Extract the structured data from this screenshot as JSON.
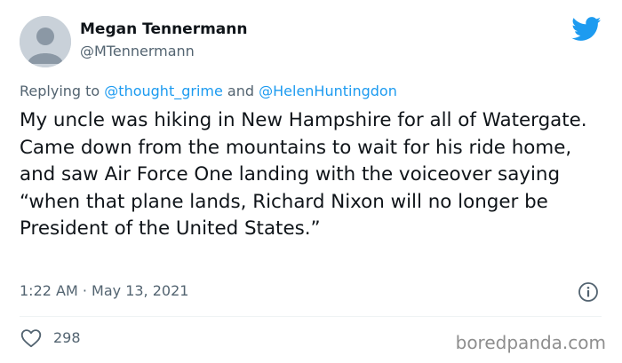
{
  "author": {
    "name": "Megan Tennermann",
    "handle": "@MTennermann"
  },
  "reply_context": {
    "prefix": "Replying to",
    "mention_1": "@thought_grime",
    "conjunction": "and",
    "mention_2": "@HelenHuntingdon"
  },
  "tweet": {
    "text": "My uncle was hiking in New Hampshire for all of Watergate. Came down from the mountains to wait for his ride home, and saw Air Force One landing with the voiceover saying “when that plane lands, Richard Nixon will no longer be President of the United States.”",
    "timestamp": "1:22 AM · May 13, 2021"
  },
  "engagement": {
    "likes": "298"
  },
  "watermark": "boredpanda.com",
  "colors": {
    "twitter_blue": "#1d9bf0",
    "secondary_text": "#536471",
    "primary_text": "#0f1419"
  },
  "icons": {
    "logo": "twitter-bird-icon",
    "info": "info-icon",
    "like": "heart-icon",
    "avatar": "default-avatar-icon"
  }
}
